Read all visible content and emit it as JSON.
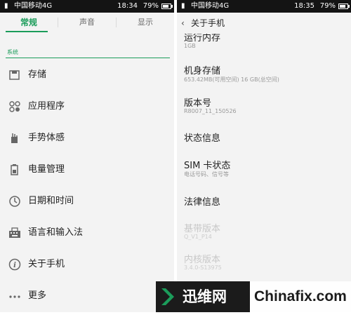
{
  "left_screen": {
    "status_bar": {
      "carrier": "中国移动4G",
      "time": "18:34",
      "battery": "79%",
      "battery_level": 0.79
    },
    "tabs": [
      {
        "label": "常规",
        "active": true
      },
      {
        "label": "声音",
        "active": false
      },
      {
        "label": "显示",
        "active": false
      }
    ],
    "section_header": "系统",
    "menu_items": [
      {
        "label": "存储",
        "icon": "storage-icon"
      },
      {
        "label": "应用程序",
        "icon": "apps-icon"
      },
      {
        "label": "手势体感",
        "icon": "gesture-icon"
      },
      {
        "label": "电量管理",
        "icon": "battery-icon"
      },
      {
        "label": "日期和时间",
        "icon": "clock-icon"
      },
      {
        "label": "语言和输入法",
        "icon": "keyboard-icon"
      },
      {
        "label": "关于手机",
        "icon": "info-icon"
      },
      {
        "label": "更多",
        "icon": "more-icon"
      }
    ]
  },
  "right_screen": {
    "status_bar": {
      "carrier": "中国移动4G",
      "time": "18:35",
      "battery": "79%",
      "battery_level": 0.79
    },
    "back_icon": "chevron-left-icon",
    "title": "关于手机",
    "items": [
      {
        "title": "运行内存",
        "subtitle": "1GB"
      },
      {
        "title": "机身存储",
        "subtitle": "653.42MB(可用空间)    16 GB(总空间)"
      },
      {
        "title": "版本号",
        "subtitle": "R8007_11_150526"
      },
      {
        "title": "状态信息",
        "subtitle": ""
      },
      {
        "title": "SIM 卡状态",
        "subtitle": "电话号码、信号等"
      },
      {
        "title": "法律信息",
        "subtitle": ""
      },
      {
        "title": "基带版本",
        "subtitle": "Q_V1_P14"
      },
      {
        "title": "内核版本",
        "subtitle": "3.4.0-S13975"
      }
    ]
  },
  "watermark": {
    "brand_cn": "迅维网",
    "brand_en": "Chinafix.com",
    "accent": "#1b9c5a"
  },
  "colors": {
    "accent_green": "#1b9c5a",
    "status_bar": "#141414",
    "background": "#f3f3f3"
  }
}
